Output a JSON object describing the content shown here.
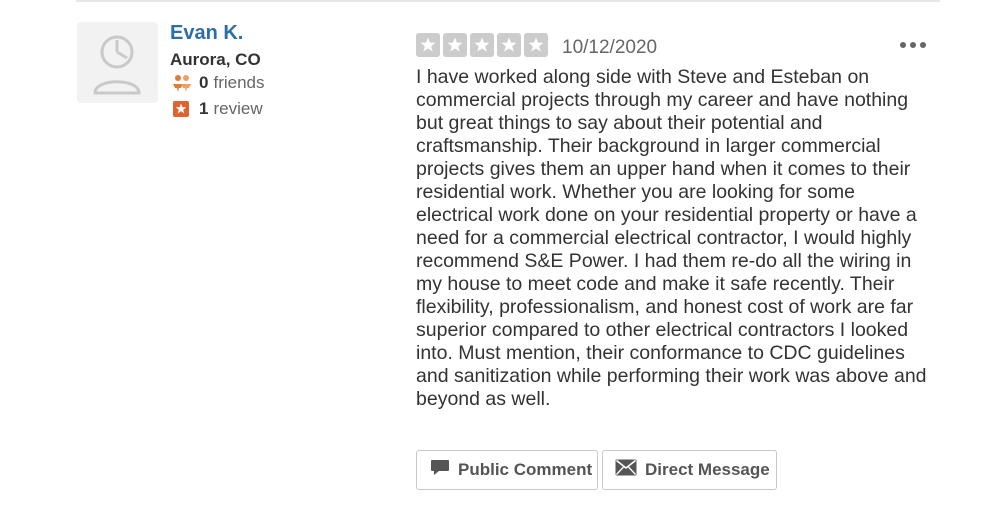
{
  "user": {
    "name": "Evan K.",
    "location": "Aurora, CO",
    "friends_count": "0",
    "friends_label": "friends",
    "reviews_count": "1",
    "reviews_label": "review"
  },
  "review": {
    "rating": 0,
    "rating_max": 5,
    "star_color": "#cccccc",
    "date": "10/12/2020",
    "text": "I have worked along side with Steve and Esteban on commercial projects through my career and have nothing but great things to say about their potential and craftsmanship. Their background in larger commercial projects gives them an upper hand when it comes to their residential work. Whether you are looking for some electrical work done on your residential property or have a need for a commercial electrical contractor, I would highly recommend S&E Power. I had them re-do all the wiring in my house to meet code and make it safe recently. Their flexibility, professionalism, and honest cost of work are far superior compared to other electrical contractors I looked into. Must mention, their conformance to CDC guidelines and sanitization while performing their work was above and beyond as well."
  },
  "actions": {
    "public_comment_label": "Public Comment",
    "direct_message_label": "Direct Message"
  },
  "icons": {
    "friends": "friends-icon",
    "review": "review-star-icon",
    "comment": "speech-bubble-icon",
    "message": "envelope-icon",
    "more": "more-options-icon"
  },
  "colors": {
    "name_link": "#2c6fa6",
    "friends_icon": "#e07b39",
    "review_icon": "#e0622f"
  }
}
